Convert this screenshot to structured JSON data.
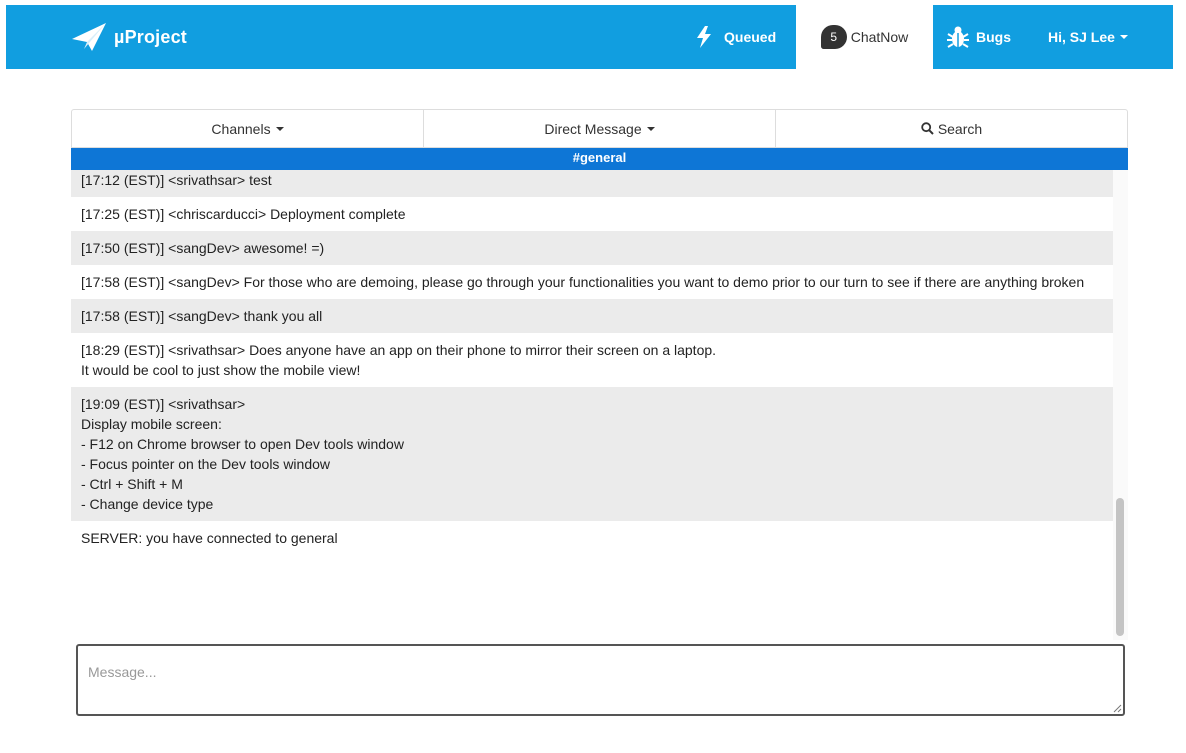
{
  "nav": {
    "brand": "µProject",
    "queued": "Queued",
    "chat_badge": "5",
    "chatnow": "ChatNow",
    "bugs": "Bugs",
    "user": "Hi, SJ Lee"
  },
  "tabs": {
    "channels": "Channels",
    "direct_message": "Direct Message",
    "search": "Search"
  },
  "channel": "#general",
  "messages": [
    {
      "lines": [
        "[17:12 (EST)] <srivathsar> test"
      ],
      "alt": true
    },
    {
      "lines": [
        "[17:25 (EST)] <chriscarducci> Deployment complete"
      ],
      "alt": false
    },
    {
      "lines": [
        "[17:50 (EST)] <sangDev> awesome! =)"
      ],
      "alt": true
    },
    {
      "lines": [
        "[17:58 (EST)] <sangDev> For those who are demoing, please go through your functionalities you want to demo prior to our turn to see if there are anything broken"
      ],
      "alt": false
    },
    {
      "lines": [
        "[17:58 (EST)] <sangDev> thank you all"
      ],
      "alt": true
    },
    {
      "lines": [
        "[18:29 (EST)] <srivathsar> Does anyone have an app on their phone to mirror their screen on a laptop.",
        "It would be cool to just show the mobile view!"
      ],
      "alt": false
    },
    {
      "lines": [
        "[19:09 (EST)] <srivathsar>",
        "Display mobile screen:",
        "- F12 on Chrome browser to open Dev tools window",
        "- Focus pointer on the Dev tools window",
        "- Ctrl + Shift + M",
        "- Change device type"
      ],
      "alt": true
    },
    {
      "lines": [
        "SERVER: you have connected to general"
      ],
      "alt": false
    }
  ],
  "input": {
    "placeholder": "Message...",
    "value": ""
  },
  "colors": {
    "navbar": "#119ee0",
    "channel_bar": "#0e76d6",
    "alt_row": "#ebebeb"
  }
}
